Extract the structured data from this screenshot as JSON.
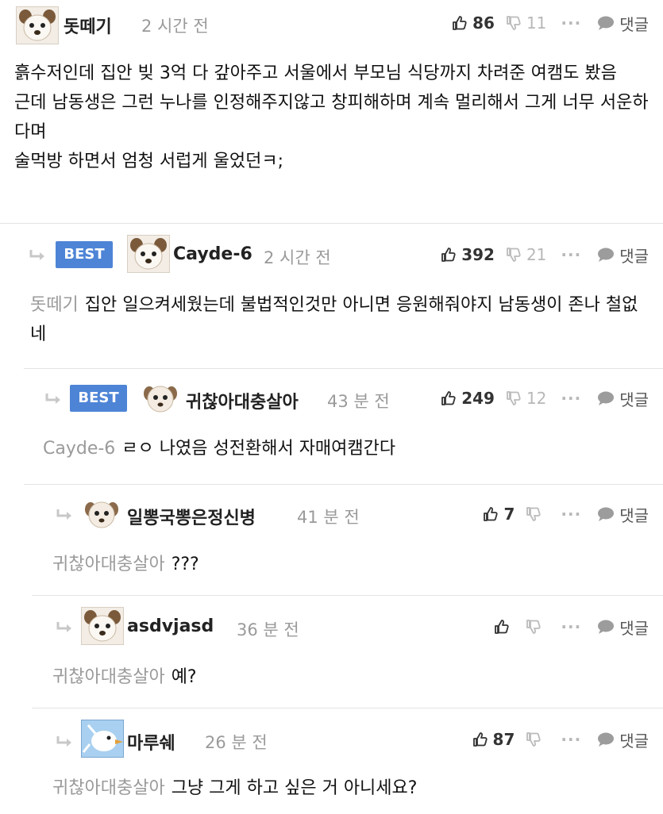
{
  "comments": [
    {
      "author": "돗떼기",
      "time": "2 시간 전",
      "likes": "86",
      "dislikes": "11",
      "more": "···",
      "reply_label": "댓글",
      "best": "",
      "mention": "",
      "text": "흙수저인데 집안 빚 3억 다 갚아주고 서울에서 부모님 식당까지 차려준 여캠도 봤음\n근데 남동생은 그런 누나를 인정해주지않고 창피해하며 계속 멀리해서 그게 너무 서운하다며\n술먹방 하면서 엄청 서럽게 울었던ㅋ;",
      "avatar_icon": "dog-avatar-icon"
    },
    {
      "author": "Cayde-6",
      "time": "2 시간 전",
      "likes": "392",
      "dislikes": "21",
      "more": "···",
      "reply_label": "댓글",
      "best": "BEST",
      "mention": "돗떼기",
      "text": "집안 일으켜세웠는데 불법적인것만 아니면 응원해줘야지 남동생이 존나 철없네",
      "avatar_icon": "dog-avatar-icon"
    },
    {
      "author": "귀찮아대충살아",
      "time": "43 분 전",
      "likes": "249",
      "dislikes": "12",
      "more": "···",
      "reply_label": "댓글",
      "best": "BEST",
      "mention": "Cayde-6",
      "text": "ㄹㅇ 나였음 성전환해서 자매여캠간다",
      "avatar_icon": "dog-avatar-icon"
    },
    {
      "author": "일뽕국뽕은정신병",
      "time": "41 분 전",
      "likes": "7",
      "dislikes": "",
      "more": "···",
      "reply_label": "댓글",
      "best": "",
      "mention": "귀찮아대충살아",
      "text": "???",
      "avatar_icon": "dog-avatar-icon"
    },
    {
      "author": "asdvjasd",
      "time": "36 분 전",
      "likes": "",
      "dislikes": "",
      "more": "···",
      "reply_label": "댓글",
      "best": "",
      "mention": "귀찮아대충살아",
      "text": "예?",
      "avatar_icon": "dog-avatar-icon"
    },
    {
      "author": "마루쉐",
      "time": "26 분 전",
      "likes": "87",
      "dislikes": "",
      "more": "···",
      "reply_label": "댓글",
      "best": "",
      "mention": "귀찮아대충살아",
      "text": "그냥 그게 하고 싶은 거 아니세요?",
      "avatar_icon": "bird-avatar-icon"
    }
  ],
  "colors": {
    "best_badge": "#4d84d6",
    "muted_text": "#9a9a9a",
    "divider": "#e3e3e3"
  }
}
